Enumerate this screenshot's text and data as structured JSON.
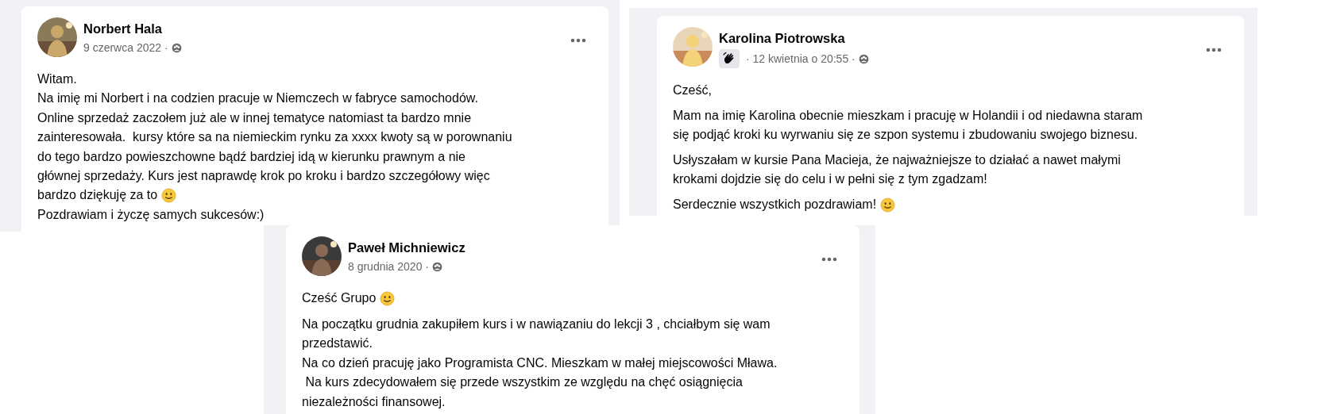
{
  "posts": [
    {
      "author": "Norbert Hala",
      "badge": false,
      "meta": "9 czerwca 2022 ·",
      "paragraphs": [
        {
          "lines": [
            {
              "text": "Witam.",
              "smiley": false
            },
            {
              "text": "Na imię mi Norbert i na codzien pracuje w Niemczech w fabryce samochodów.",
              "smiley": false
            },
            {
              "text": "Online sprzedaż zaczołem już ale w innej tematyce natomiast ta bardzo mnie",
              "smiley": false
            },
            {
              "text": "zainteresowała.  kursy które sa na niemieckim rynku za xxxx kwoty są w porownaniu",
              "smiley": false
            },
            {
              "text": "do tego bardzo powieszchowne bądź bardziej idą w kierunku prawnym a nie",
              "smiley": false
            },
            {
              "text": "głównej sprzedaży. Kurs jest naprawdę krok po kroku i bardzo szczegółowy więc",
              "smiley": false
            },
            {
              "text": "bardzo dziękuję za to",
              "smiley": true
            },
            {
              "text": "Pozdrawiam i życzę samych sukcesów:)",
              "smiley": false
            }
          ]
        }
      ]
    },
    {
      "author": "Karolina Piotrowska",
      "badge": true,
      "meta": "· 12 kwietnia o 20:55 ·",
      "paragraphs": [
        {
          "lines": [
            {
              "text": "Cześć,",
              "smiley": false
            }
          ]
        },
        {
          "lines": [
            {
              "text": "Mam na imię Karolina obecnie mieszkam i pracuję w Holandii i od niedawna staram",
              "smiley": false
            },
            {
              "text": "się podjąć kroki ku wyrwaniu się ze szpon systemu i zbudowaniu swojego biznesu.",
              "smiley": false
            }
          ]
        },
        {
          "lines": [
            {
              "text": "Usłyszałam w kursie Pana Macieja, że najważniejsze to działać a nawet małymi",
              "smiley": false
            },
            {
              "text": "krokami dojdzie się do celu i w pełni się z tym zgadzam!",
              "smiley": false
            }
          ]
        },
        {
          "lines": [
            {
              "text": "Serdecznie wszystkich pozdrawiam!",
              "smiley": true
            }
          ]
        }
      ]
    },
    {
      "author": "Paweł Michniewicz",
      "badge": false,
      "meta": "8 grudnia 2020 ·",
      "paragraphs": [
        {
          "lines": [
            {
              "text": "Cześć Grupo",
              "smiley": true
            }
          ]
        },
        {
          "lines": [
            {
              "text": "Na początku grudnia zakupiłem kurs i w nawiązaniu do lekcji 3 , chciałbym się wam",
              "smiley": false
            },
            {
              "text": "przedstawić.",
              "smiley": false
            },
            {
              "text": "Na co dzień pracuję jako Programista CNC. Mieszkam w małej miejscowości Mława.",
              "smiley": false
            },
            {
              "text": " Na kurs zdecydowałem się przede wszystkim ze względu na chęć osiągnięcia",
              "smiley": false
            },
            {
              "text": "niezależności finansowej.",
              "smiley": false
            }
          ]
        }
      ]
    }
  ]
}
